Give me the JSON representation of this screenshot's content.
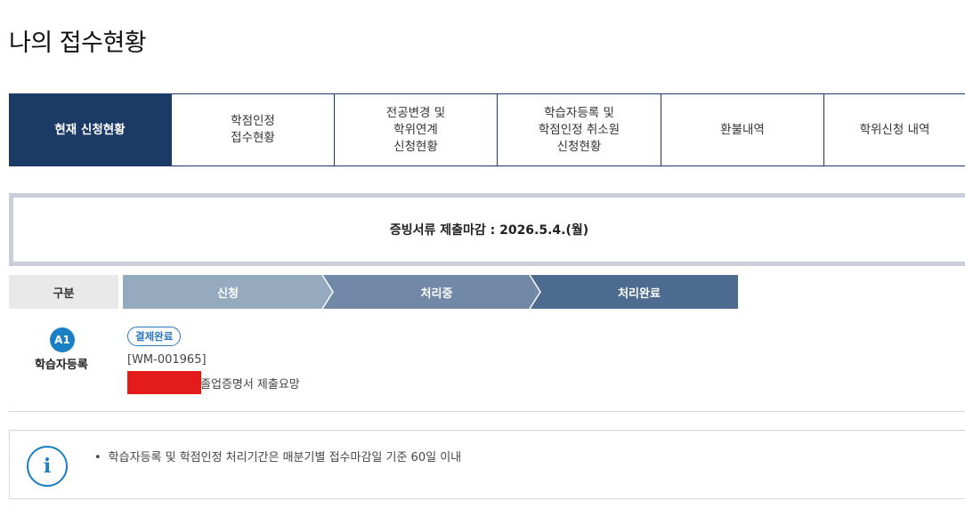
{
  "page_title": "나의 접수현황",
  "tabs": [
    {
      "label": "현재 신청현황",
      "active": true
    },
    {
      "label": "학점인정\n접수현황",
      "active": false
    },
    {
      "label": "전공변경 및\n학위연계\n신청현황",
      "active": false
    },
    {
      "label": "학습자등록 및\n학점인정 취소원\n신청현황",
      "active": false
    },
    {
      "label": "환불내역",
      "active": false
    },
    {
      "label": "학위신청 내역",
      "active": false
    }
  ],
  "deadline_notice": "증빙서류 제출마감 : 2026.5.4.(월)",
  "progress": {
    "header_label": "구분",
    "steps": [
      "신청",
      "처리중",
      "처리완료"
    ],
    "colors": [
      "#96aabf",
      "#7189a6",
      "#4d6b8f"
    ]
  },
  "application": {
    "badge": "A1",
    "type": "학습자등록",
    "status": "결제완료",
    "doc_number": "[WM-001965]",
    "doc_message": "졸업증명서 제출요망"
  },
  "info": {
    "icon": "info-icon",
    "text": "학습자등록 및 학점인정 처리기간은 매분기별 접수마감일 기준 60일 이내"
  },
  "colors": {
    "primary": "#1b3a66",
    "accent": "#1a7fc4",
    "redaction": "#e41b1b"
  }
}
